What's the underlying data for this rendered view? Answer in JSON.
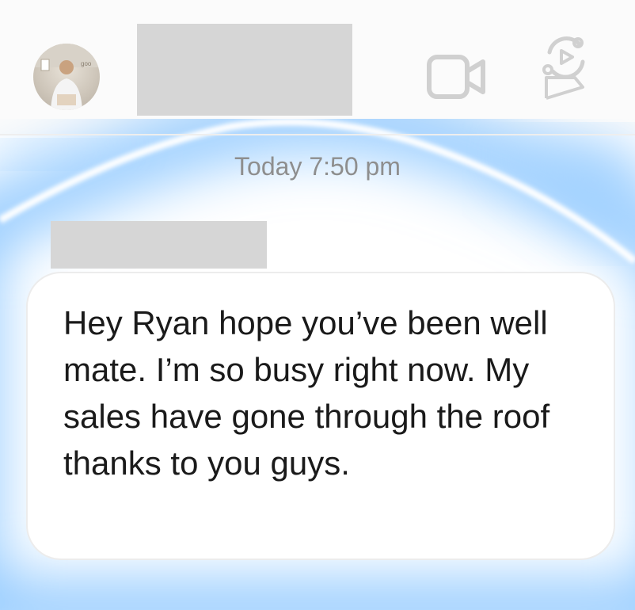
{
  "header": {
    "avatar_alt": "contact avatar",
    "video_call_icon": "video-camera-icon",
    "live_icon": "live-video-icon"
  },
  "conversation": {
    "timestamp": "Today 7:50 pm",
    "messages": [
      {
        "text": "Hey Ryan hope you’ve been well mate. I’m so busy right now. My sales have gone through the roof thanks to you guys."
      }
    ]
  },
  "colors": {
    "glow": "#8ec8ff",
    "header_bg": "#fbfbfb",
    "redaction": "#d6d6d6",
    "timestamp": "#8e8e8e",
    "text": "#1a1a1a"
  }
}
